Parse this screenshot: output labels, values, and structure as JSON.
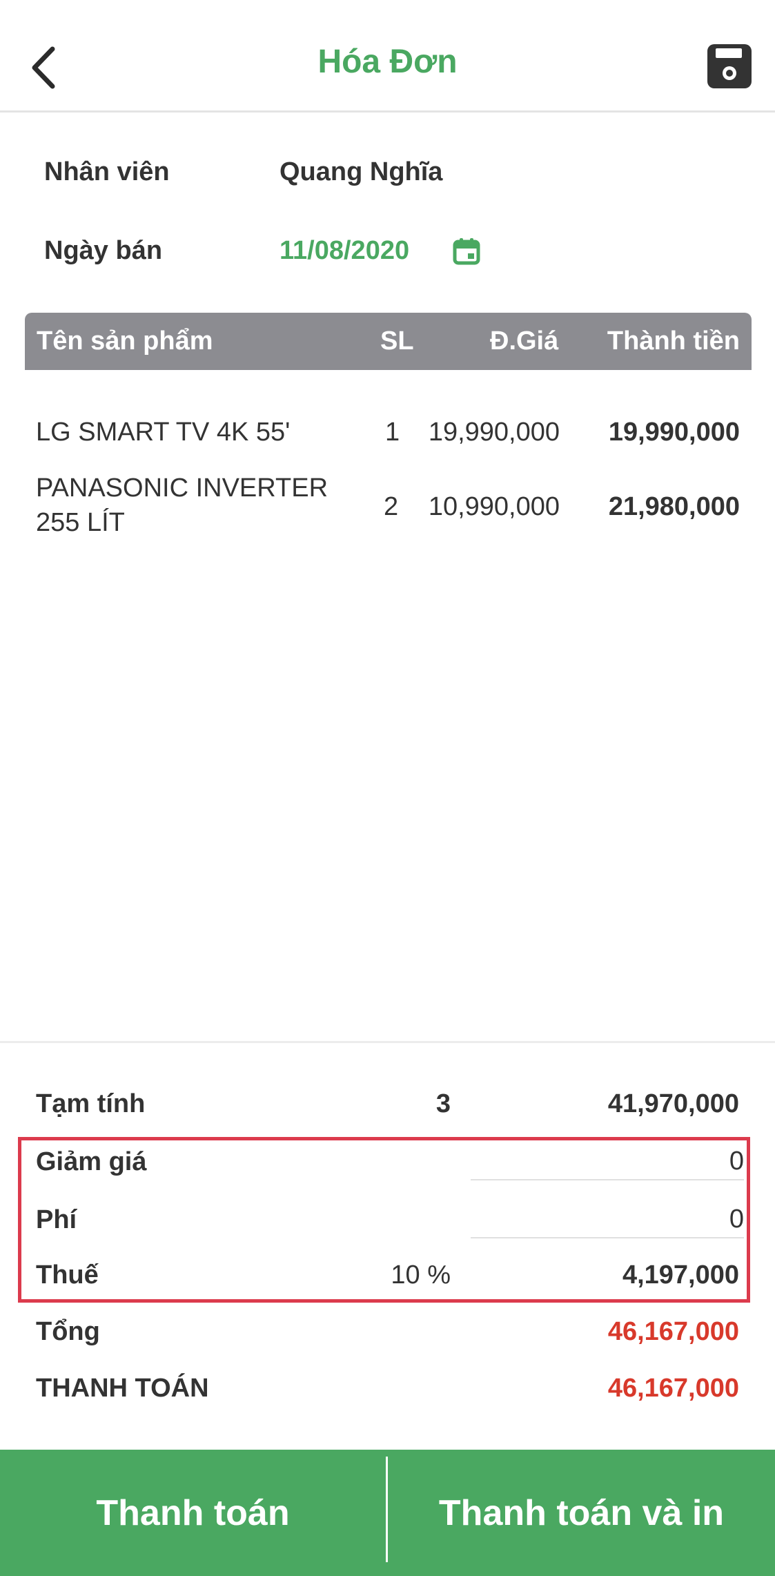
{
  "header": {
    "title": "Hóa Đơn",
    "back_icon": "chevron-left-icon",
    "save_icon": "floppy-disk-icon"
  },
  "info": {
    "staff_label": "Nhân viên",
    "staff_value": "Quang Nghĩa",
    "date_label": "Ngày bán",
    "date_value": "11/08/2020",
    "date_icon": "calendar-icon"
  },
  "table": {
    "headers": {
      "name": "Tên sản phẩm",
      "qty": "SL",
      "price": "Đ.Giá",
      "total": "Thành tiền"
    },
    "rows": [
      {
        "name_line1": "LG SMART TV 4K 55'",
        "name_line2": "",
        "qty": "1",
        "price": "19,990,000",
        "total": "19,990,000"
      },
      {
        "name_line1": "PANASONIC INVERTER",
        "name_line2": "255 LÍT",
        "qty": "2",
        "price": "10,990,000",
        "total": "21,980,000"
      }
    ]
  },
  "summary": {
    "subtotal_label": "Tạm tính",
    "subtotal_qty": "3",
    "subtotal_value": "41,970,000",
    "discount_label": "Giảm giá",
    "discount_value": "0",
    "fee_label": "Phí",
    "fee_value": "0",
    "tax_label": "Thuế",
    "tax_rate": "10 %",
    "tax_value": "4,197,000",
    "total_label": "Tổng",
    "total_value": "46,167,000",
    "payment_label": "THANH TOÁN",
    "payment_value": "46,167,000"
  },
  "actions": {
    "pay_label": "Thanh toán",
    "pay_print_label": "Thanh toán và in"
  },
  "colors": {
    "accent": "#4aa861",
    "header_row": "#8c8c91",
    "total_red": "#d8392b",
    "highlight": "#dc3b4d"
  }
}
